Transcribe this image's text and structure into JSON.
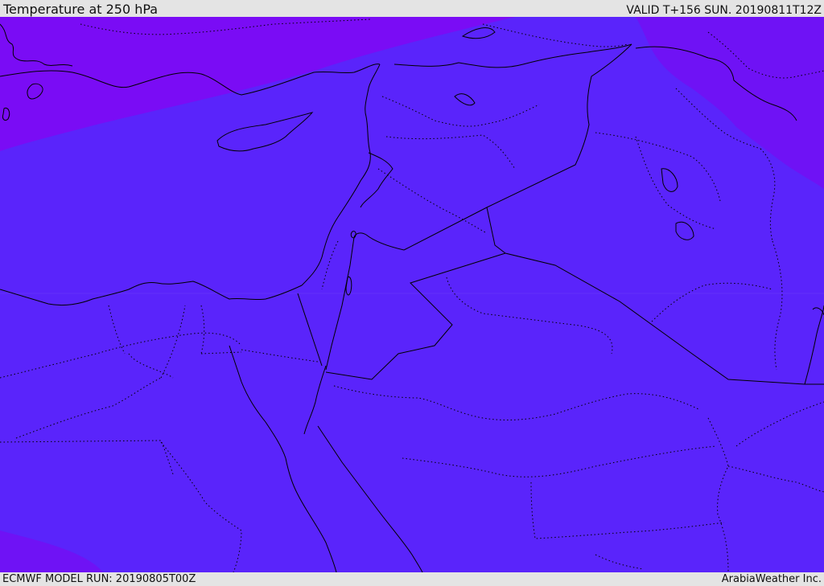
{
  "header": {
    "title": "Temperature at 250 hPa",
    "valid": "VALID T+156 SUN. 20190811T12Z"
  },
  "footer": {
    "model_run": "ECMWF MODEL RUN: 20190805T00Z",
    "credit": "ArabiaWeather Inc."
  },
  "colors": {
    "field_main": "#5a24fb",
    "field_cold_north": "#7a0cf5",
    "field_northeast": "#6f12f5",
    "coastline": "#000000",
    "border": "#000000"
  }
}
